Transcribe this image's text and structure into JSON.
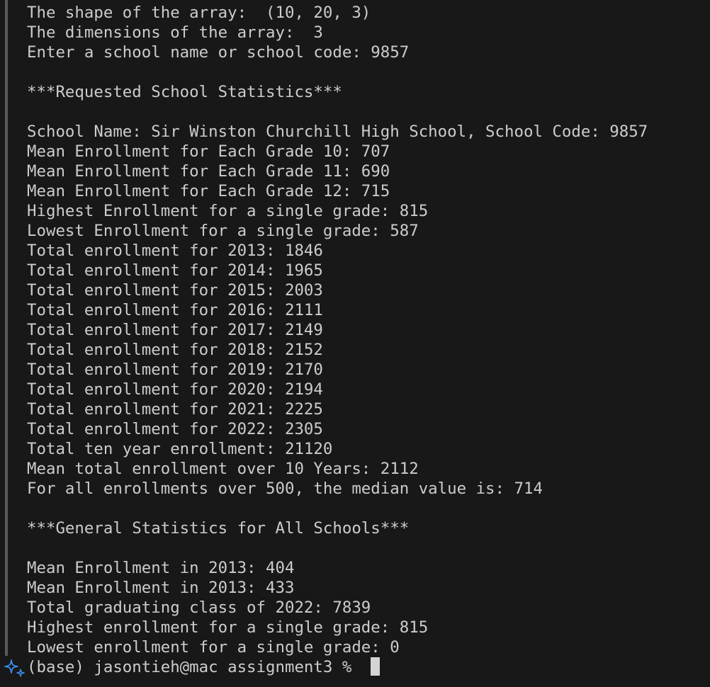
{
  "terminal": {
    "lines": [
      "The shape of the array:  (10, 20, 3)",
      "The dimensions of the array:  3",
      "Enter a school name or school code: 9857",
      "",
      "***Requested School Statistics***",
      "",
      "School Name: Sir Winston Churchill High School, School Code: 9857",
      "Mean Enrollment for Each Grade 10: 707",
      "Mean Enrollment for Each Grade 11: 690",
      "Mean Enrollment for Each Grade 12: 715",
      "Highest Enrollment for a single grade: 815",
      "Lowest Enrollment for a single grade: 587",
      "Total enrollment for 2013: 1846",
      "Total enrollment for 2014: 1965",
      "Total enrollment for 2015: 2003",
      "Total enrollment for 2016: 2111",
      "Total enrollment for 2017: 2149",
      "Total enrollment for 2018: 2152",
      "Total enrollment for 2019: 2170",
      "Total enrollment for 2020: 2194",
      "Total enrollment for 2021: 2225",
      "Total enrollment for 2022: 2305",
      "Total ten year enrollment: 21120",
      "Mean total enrollment over 10 Years: 2112",
      "For all enrollments over 500, the median value is: 714",
      "",
      "***General Statistics for All Schools***",
      "",
      "Mean Enrollment in 2013: 404",
      "Mean Enrollment in 2013: 433",
      "Total graduating class of 2022: 7839",
      "Highest enrollment for a single grade: 815",
      "Lowest enrollment for a single grade: 0"
    ],
    "prompt": "(base) jasontieh@mac assignment3 % "
  },
  "icons": {
    "prompt_icon": "sparkle-icon"
  },
  "colors": {
    "background": "#181818",
    "text": "#cccccc",
    "cursor": "#d4d4d4",
    "accent": "#3b8eea"
  }
}
